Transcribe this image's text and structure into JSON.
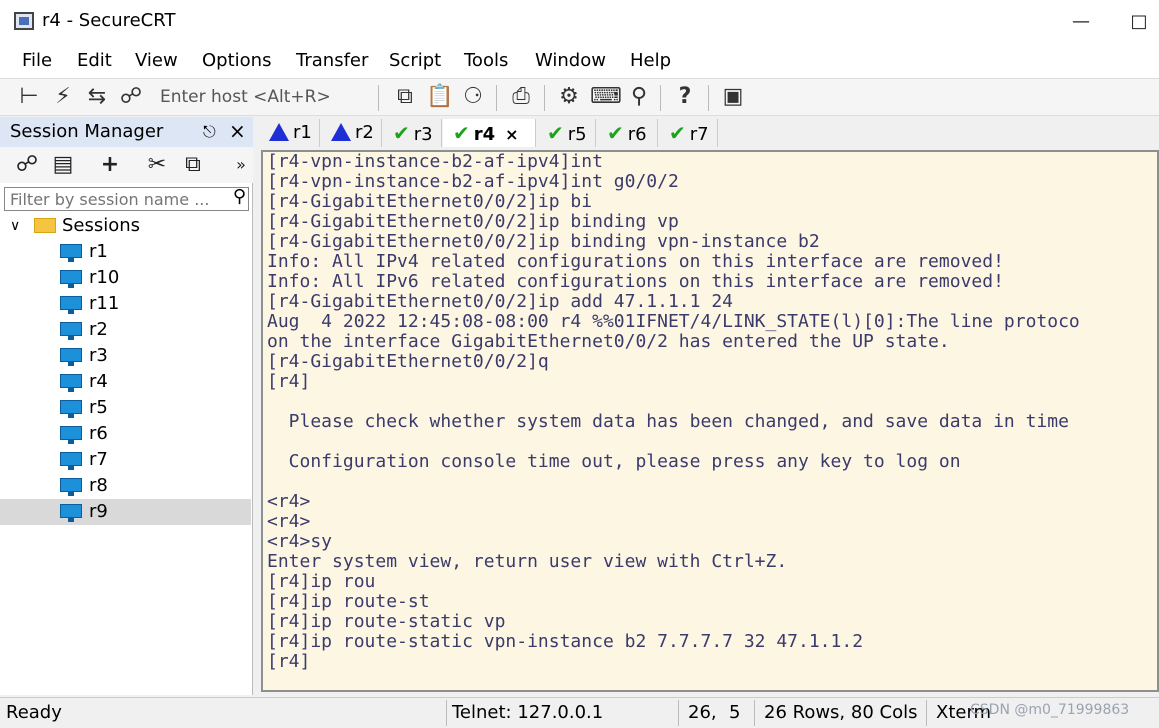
{
  "window": {
    "title": "r4 - SecureCRT"
  },
  "menu": [
    "File",
    "Edit",
    "View",
    "Options",
    "Transfer",
    "Script",
    "Tools",
    "Window",
    "Help"
  ],
  "toolbar": {
    "enter_host": "Enter host <Alt+R>"
  },
  "session_manager": {
    "title": "Session Manager",
    "filter_placeholder": "Filter by session name ...",
    "root": "Sessions",
    "sessions": [
      "r1",
      "r10",
      "r11",
      "r2",
      "r3",
      "r4",
      "r5",
      "r6",
      "r7",
      "r8",
      "r9"
    ],
    "selected": "r9"
  },
  "tabs": [
    {
      "label": "r1",
      "status": "warning"
    },
    {
      "label": "r2",
      "status": "warning"
    },
    {
      "label": "r3",
      "status": "connected"
    },
    {
      "label": "r4",
      "status": "connected",
      "active": true
    },
    {
      "label": "r5",
      "status": "connected"
    },
    {
      "label": "r6",
      "status": "connected"
    },
    {
      "label": "r7",
      "status": "connected"
    }
  ],
  "terminal": {
    "lines": [
      "[r4-vpn-instance-b2-af-ipv4]int",
      "[r4-vpn-instance-b2-af-ipv4]int g0/0/2",
      "[r4-GigabitEthernet0/0/2]ip bi",
      "[r4-GigabitEthernet0/0/2]ip binding vp",
      "[r4-GigabitEthernet0/0/2]ip binding vpn-instance b2",
      "Info: All IPv4 related configurations on this interface are removed!",
      "Info: All IPv6 related configurations on this interface are removed!",
      "[r4-GigabitEthernet0/0/2]ip add 47.1.1.1 24",
      "Aug  4 2022 12:45:08-08:00 r4 %%01IFNET/4/LINK_STATE(l)[0]:The line protoco",
      "on the interface GigabitEthernet0/0/2 has entered the UP state.",
      "[r4-GigabitEthernet0/0/2]q",
      "[r4]",
      "",
      "  Please check whether system data has been changed, and save data in time",
      "",
      "  Configuration console time out, please press any key to log on",
      "",
      "<r4>",
      "<r4>",
      "<r4>sy",
      "Enter system view, return user view with Ctrl+Z.",
      "[r4]ip rou",
      "[r4]ip route-st",
      "[r4]ip route-static vp",
      "[r4]ip route-static vpn-instance b2 7.7.7.7 32 47.1.1.2",
      "[r4]"
    ]
  },
  "status": {
    "ready": "Ready",
    "connection": "Telnet: 127.0.0.1",
    "row": "26,",
    "col": "5",
    "size": "26 Rows, 80 Cols",
    "emulation": "Xterm",
    "watermark": "CSDN @m0_71999863"
  }
}
